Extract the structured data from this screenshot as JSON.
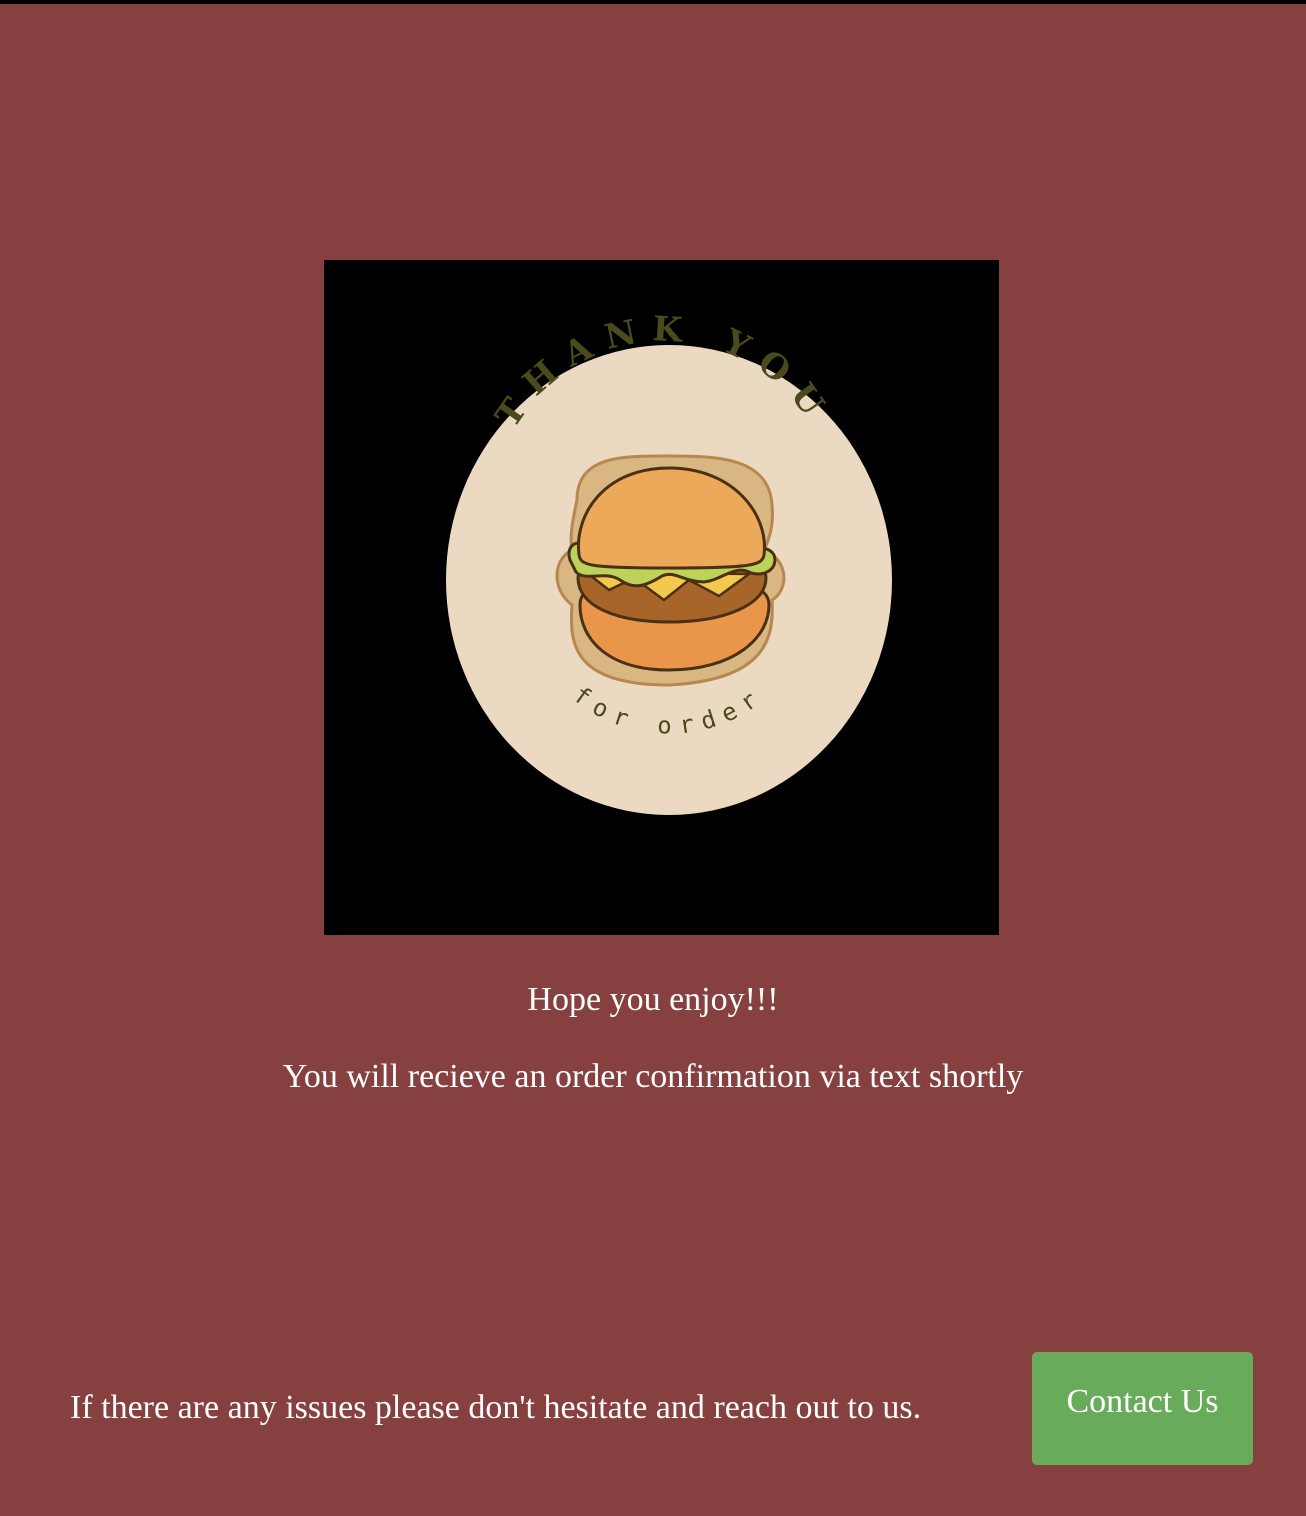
{
  "colors": {
    "page_background": "#864040",
    "hero_background": "#000000",
    "badge_fill": "#ebd9c1",
    "badge_text": "#4a4a1c",
    "button_background": "#68ac5b",
    "text": "#ffffff"
  },
  "hero": {
    "icon": "burger-icon",
    "badge_title": "THANK YOU",
    "badge_subtitle": "for order"
  },
  "messages": {
    "enjoy": "Hope you enjoy!!!",
    "confirmation": "You will recieve an order confirmation via text shortly"
  },
  "footer": {
    "issues_text": "If there are any issues please don't hesitate and reach out to us.",
    "contact_label": "Contact Us"
  }
}
